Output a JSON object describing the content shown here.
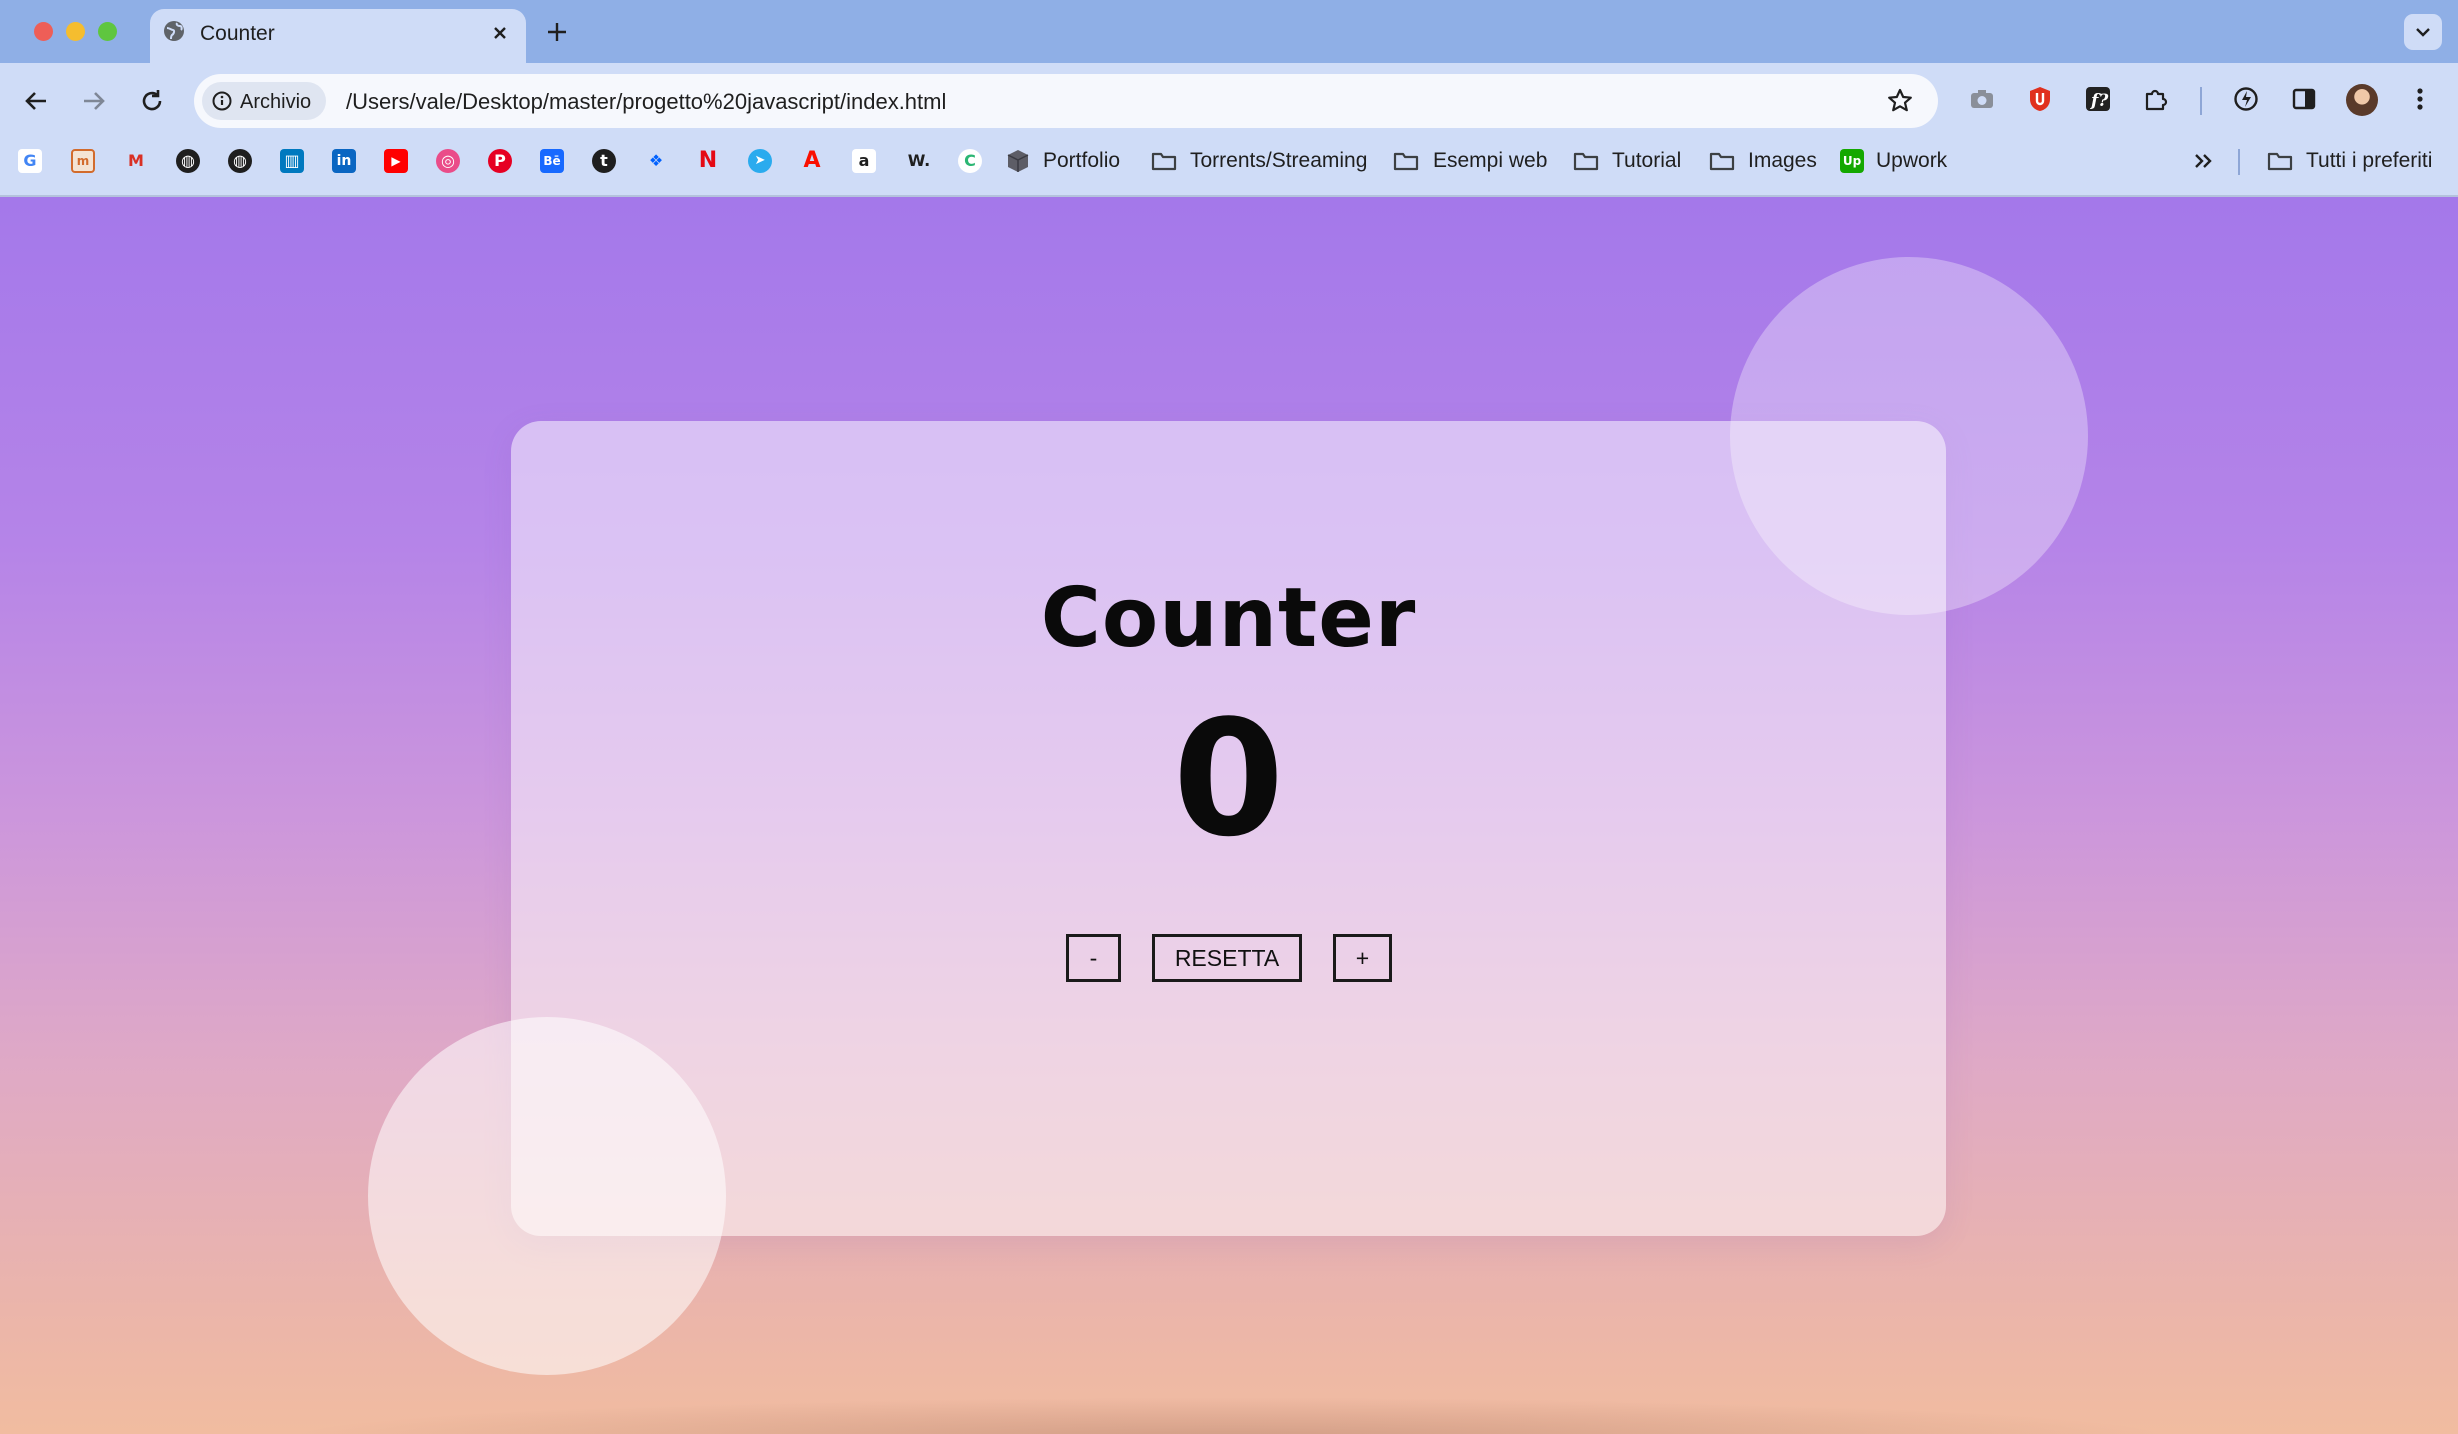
{
  "browser": {
    "tab": {
      "title": "Counter"
    },
    "address": {
      "security_chip": "Archivio",
      "url": "/Users/vale/Desktop/master/progetto%20javascript/index.html"
    },
    "bookmarks": {
      "folders": [
        "Portfolio",
        "Torrents/Streaming",
        "Esempi web",
        "Tutorial",
        "Images",
        "Upwork"
      ],
      "all_bookmarks": "Tutti i preferiti",
      "icons": [
        "google-icon",
        "markup-icon",
        "gmail-icon",
        "globe-icon",
        "globe-icon",
        "trello-icon",
        "linkedin-icon",
        "youtube-icon",
        "dribbble-icon",
        "pinterest-icon",
        "behance-icon",
        "tumblr-icon",
        "dropbox-icon",
        "netflix-icon",
        "telegram-icon",
        "adobe-icon",
        "amazon-icon",
        "wordreference-icon",
        "chromatic-icon"
      ]
    }
  },
  "counter": {
    "title": "Counter",
    "value": "0",
    "minus_label": "-",
    "reset_label": "RESETTA",
    "plus_label": "+"
  },
  "colors": {
    "tab_strip": "#8fafe6",
    "toolbar": "#cfdcf7",
    "page_top": "#a478ea",
    "page_bottom": "#f1bca0"
  }
}
